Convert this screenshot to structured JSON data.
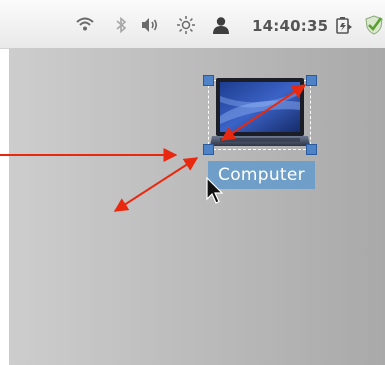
{
  "panel": {
    "clock": "14:40:35",
    "icons": [
      "wifi-icon",
      "bluetooth-icon",
      "volume-icon",
      "brightness-icon",
      "user-icon",
      "battery-icon",
      "checkmark-icon"
    ]
  },
  "desktop": {
    "selected_icon": {
      "label": "Computer",
      "icon": "laptop-icon"
    }
  },
  "annotations": {
    "arrow_color": "#e8290f"
  }
}
